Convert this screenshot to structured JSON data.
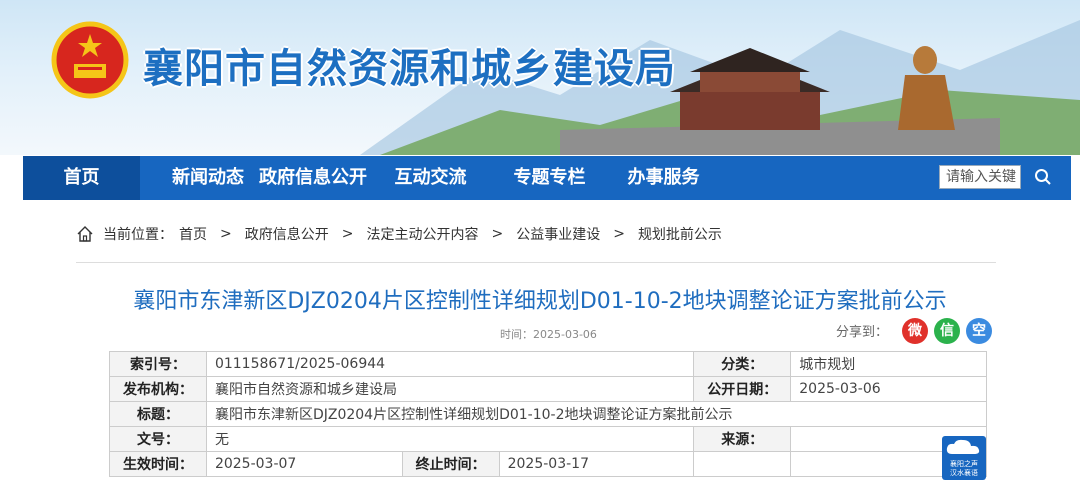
{
  "site": {
    "title": "襄阳市自然资源和城乡建设局"
  },
  "nav": {
    "items": [
      "首页",
      "新闻动态",
      "政府信息公开",
      "互动交流",
      "专题专栏",
      "办事服务"
    ],
    "search_placeholder": "请输入关键",
    "search_icon": "magnifier-icon"
  },
  "breadcrumb": {
    "label": "当前位置：",
    "items": [
      "首页",
      "政府信息公开",
      "法定主动公开内容",
      "公益事业建设",
      "规划批前公示"
    ],
    "separator": ">"
  },
  "article": {
    "title": "襄阳市东津新区DJZ0204片区控制性详细规划D01-10-2地块调整论证方案批前公示",
    "time": "时间：2025-03-06",
    "share_label": "分享到："
  },
  "meta": {
    "index_label": "索引号：",
    "index_value": "011158671/2025-06944",
    "category_label": "分类：",
    "category_value": "城市规划",
    "publisher_label": "发布机构：",
    "publisher_value": "襄阳市自然资源和城乡建设局",
    "pubdate_label": "公开日期：",
    "pubdate_value": "2025-03-06",
    "title_label": "标题：",
    "title_value": "襄阳市东津新区DJZ0204片区控制性详细规划D01-10-2地块调整论证方案批前公示",
    "docno_label": "文号：",
    "docno_value": "无",
    "source_label": "来源：",
    "source_value": "",
    "effective_label": "生效时间：",
    "effective_value": "2025-03-07",
    "end_label": "终止时间：",
    "end_value": "2025-03-17"
  },
  "badge": {
    "line1": "襄阳之声",
    "line2": "汉水襄语"
  },
  "colors": {
    "brand": "#1766c0",
    "title": "#1f6dbf"
  }
}
